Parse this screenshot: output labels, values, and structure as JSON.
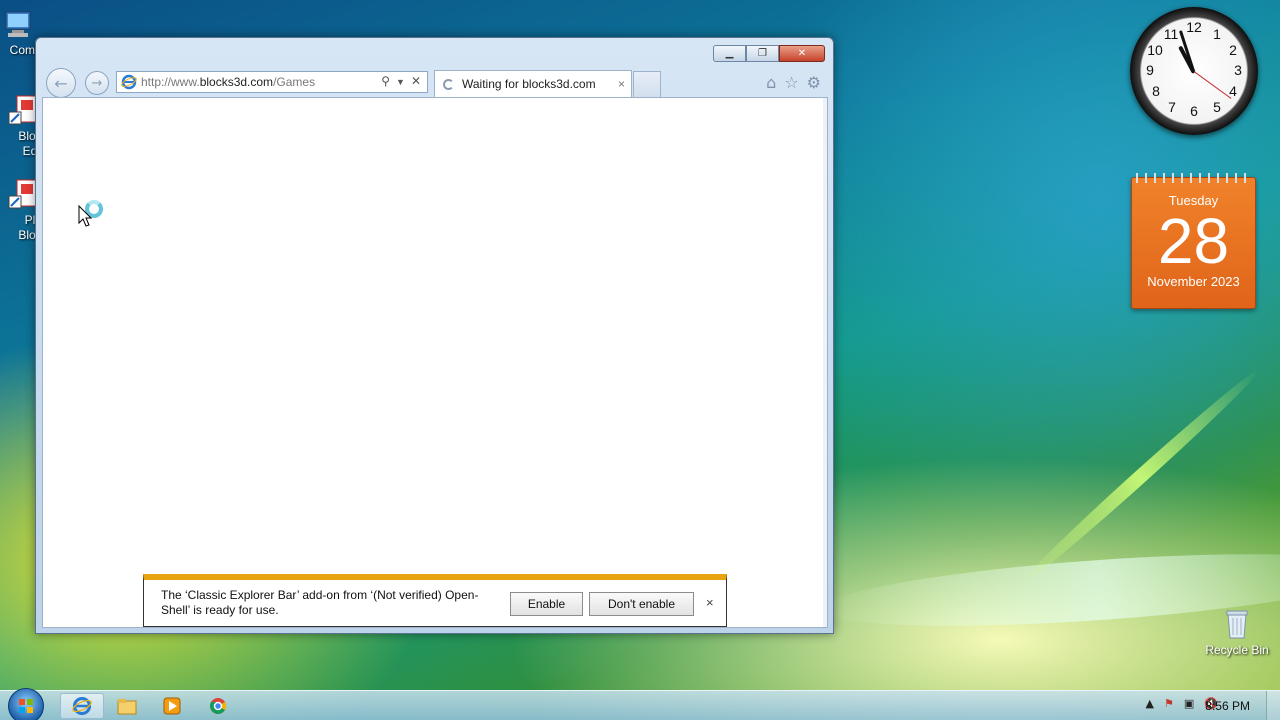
{
  "desktop": {
    "icons": [
      {
        "label": "Com",
        "name": "computer"
      },
      {
        "label": "Bloc\nEd",
        "name": "blocks-editor"
      },
      {
        "label": "Pl\nBloc",
        "name": "play-blocks"
      }
    ],
    "recycle_bin_label": "Recycle Bin"
  },
  "browser": {
    "url_prefix": "http://www.",
    "url_host": "blocks3d.com",
    "url_path": "/Games",
    "tab_title": "Waiting for blocks3d.com",
    "tab_close": "×"
  },
  "notification": {
    "message": "The ‘Classic Explorer Bar’ add-on from ‘(Not verified) Open-Shell’ is ready for use.",
    "enable_label": "Enable",
    "dont_enable_label": "Don't enable",
    "close_label": "×",
    "accent_color": "#e8a311"
  },
  "clock": {
    "numbers": [
      "12",
      "1",
      "2",
      "3",
      "4",
      "5",
      "6",
      "7",
      "8",
      "9",
      "10",
      "11"
    ]
  },
  "calendar": {
    "day_of_week": "Tuesday",
    "day": "28",
    "month_year": "November 2023"
  },
  "taskbar": {
    "time": "8:56 PM",
    "pinned": [
      "internet-explorer",
      "file-explorer",
      "media-player",
      "chrome"
    ]
  }
}
